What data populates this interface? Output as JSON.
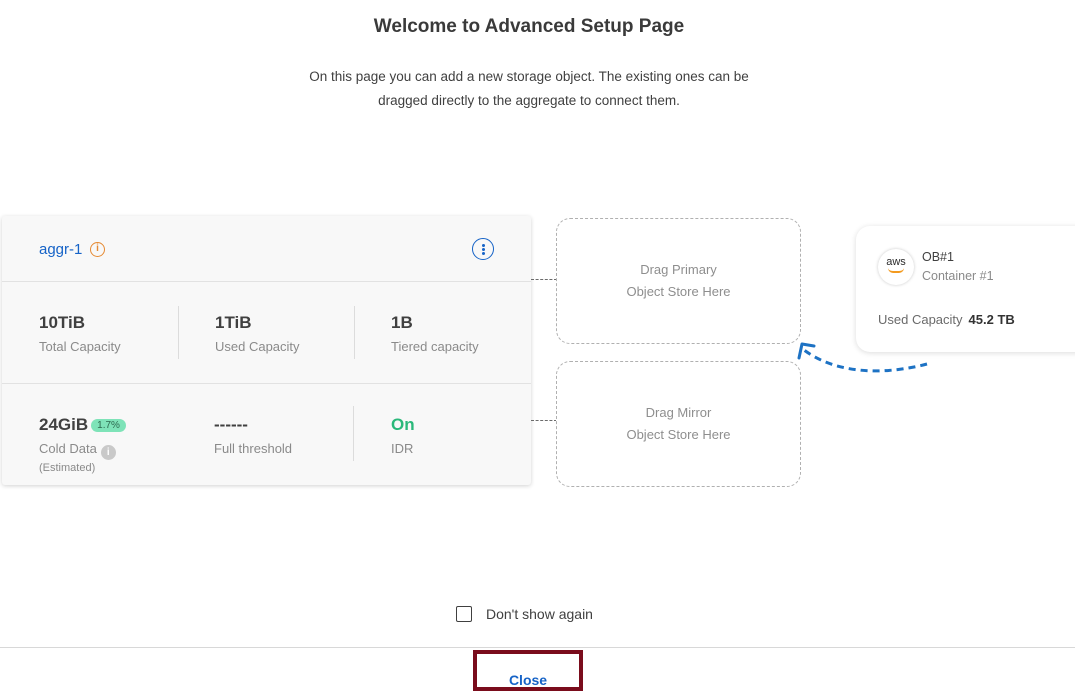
{
  "header": {
    "title": "Welcome to Advanced Setup Page",
    "subtitle_line1": "On this page you can add a new storage object. The existing ones can be",
    "subtitle_line2": "dragged directly to the aggregate to connect them."
  },
  "aggregate": {
    "name": "aggr-1",
    "info_icon": "info-icon",
    "menu_icon": "more-vertical-icon",
    "total_capacity": {
      "value": "10TiB",
      "label": "Total Capacity"
    },
    "used_capacity": {
      "value": "1TiB",
      "label": "Used Capacity"
    },
    "tiered_capacity": {
      "value": "1B",
      "label": "Tiered capacity"
    },
    "cold_data": {
      "value": "24GiB",
      "badge": "1.7%",
      "label": "Cold Data",
      "note": "(Estimated)"
    },
    "full_threshold": {
      "value": "------",
      "label": "Full threshold"
    },
    "idr": {
      "value": "On",
      "label": "IDR"
    }
  },
  "drop_zones": {
    "primary_line1": "Drag Primary",
    "primary_line2": "Object Store Here",
    "mirror_line1": "Drag Mirror",
    "mirror_line2": "Object Store Here"
  },
  "object_store": {
    "logo_text": "aws",
    "name": "OB#1",
    "container": "Container #1",
    "used_capacity_label": "Used Capacity",
    "used_capacity_value": "45.2 TB"
  },
  "footer": {
    "dont_show_label": "Don't show again",
    "dont_show_checked": false,
    "close_label": "Close"
  },
  "colors": {
    "accent": "#1663c7",
    "warning": "#e58a33",
    "success": "#2ab87a",
    "badge_bg": "#7ee3b8",
    "close_border": "#7a0c1c"
  }
}
